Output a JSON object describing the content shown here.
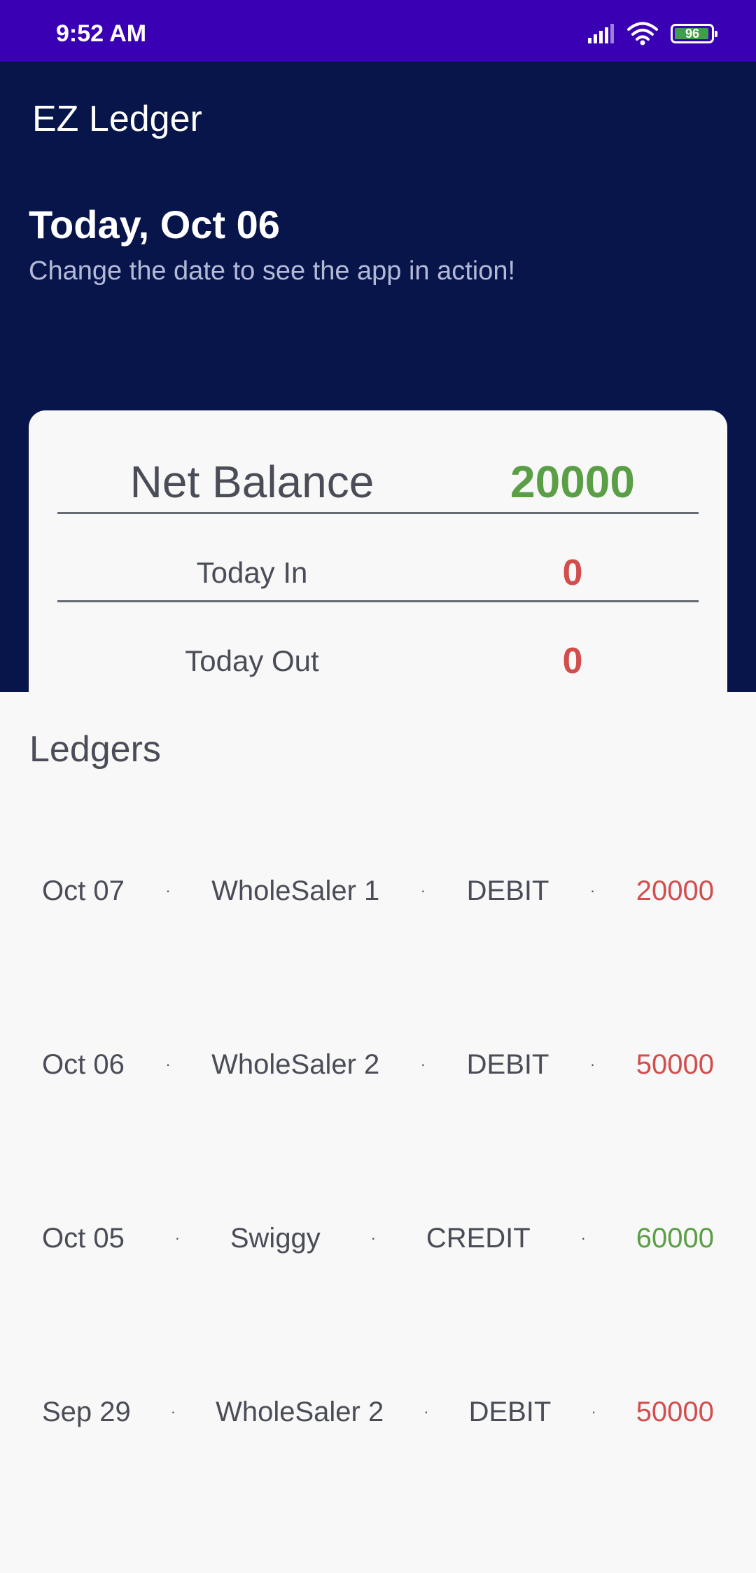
{
  "status_bar": {
    "time": "9:52 AM",
    "battery_level": "96",
    "battery_fraction": 0.96,
    "icons": [
      "signal-icon",
      "wifi-icon",
      "battery-icon"
    ]
  },
  "app": {
    "title": "EZ Ledger"
  },
  "date_section": {
    "title": "Today, Oct 06",
    "subtitle": "Change the date to see the app in action!"
  },
  "balance_card": {
    "net_balance_label": "Net Balance",
    "net_balance_value": "20000",
    "today_in_label": "Today In",
    "today_in_value": "0",
    "today_out_label": "Today Out",
    "today_out_value": "0"
  },
  "ledgers": {
    "title": "Ledgers",
    "separator": "·",
    "items": [
      {
        "date": "Oct 07",
        "party": "WholeSaler 1",
        "type": "DEBIT",
        "amount": "20000"
      },
      {
        "date": "Oct 06",
        "party": "WholeSaler 2",
        "type": "DEBIT",
        "amount": "50000"
      },
      {
        "date": "Oct 05",
        "party": "Swiggy",
        "type": "CREDIT",
        "amount": "60000"
      },
      {
        "date": "Sep 29",
        "party": "WholeSaler 2",
        "type": "DEBIT",
        "amount": "50000"
      }
    ]
  },
  "colors": {
    "status_bar": "#3a00b3",
    "header": "#07154a",
    "positive": "#5a9e46",
    "negative": "#d34d4d",
    "text": "#4a4d57"
  }
}
